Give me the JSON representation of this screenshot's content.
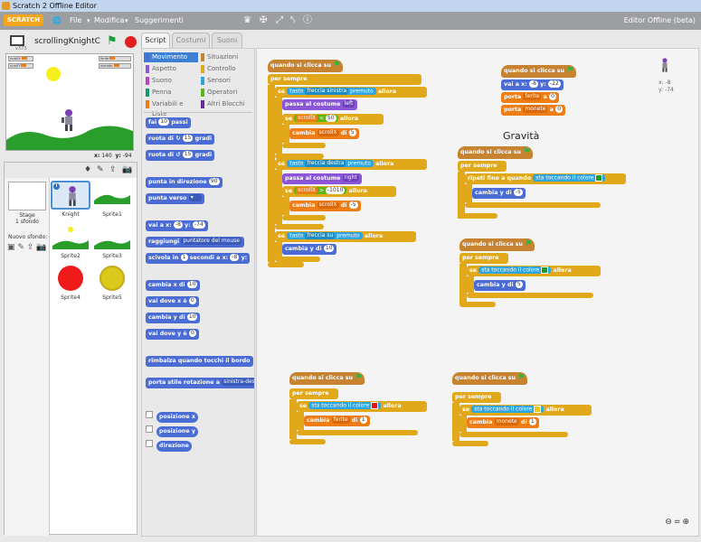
{
  "window": {
    "title": "Scratch 2 Offline Editor"
  },
  "menu": {
    "logo": "SCRATCH",
    "file": "File",
    "edit": "Modifica",
    "tips": "Suggerimenti",
    "edition": "Editor Offline (beta)",
    "tools": [
      "duplicate-stamp-icon",
      "cut-icon",
      "grow-icon",
      "shrink-icon",
      "help-icon"
    ]
  },
  "stage_header": {
    "version": "v373",
    "project_name": "scrollingKnightC"
  },
  "stage": {
    "monitors": [
      "scrollX",
      "scrollY",
      "ferite",
      "monete"
    ],
    "mouse_x_label": "x:",
    "mouse_x": "140",
    "mouse_y_label": "y:",
    "mouse_y": "-94"
  },
  "sprites_panel": {
    "stage_label": "Stage",
    "stage_backdrops": "1 sfondo",
    "new_backdrop": "Nuovo sfondo:",
    "sprites": [
      {
        "name": "Knight",
        "selected": true
      },
      {
        "name": "Sprite1"
      },
      {
        "name": "Sprite2"
      },
      {
        "name": "Sprite3"
      },
      {
        "name": "Sprite4"
      },
      {
        "name": "Sprite5"
      }
    ]
  },
  "tabs": [
    {
      "label": "Script",
      "active": true
    },
    {
      "label": "Costumi"
    },
    {
      "label": "Suoni"
    }
  ],
  "categories": [
    {
      "label": "Movimento",
      "color": "#4a6cd4",
      "active": true
    },
    {
      "label": "Aspetto",
      "color": "#8a55d7"
    },
    {
      "label": "Suono",
      "color": "#bb42c3"
    },
    {
      "label": "Penna",
      "color": "#0e9a6c"
    },
    {
      "label": "Variabili e Liste",
      "color": "#ee7d16"
    },
    {
      "label": "Situazioni",
      "color": "#c88330"
    },
    {
      "label": "Controllo",
      "color": "#e1a91a"
    },
    {
      "label": "Sensori",
      "color": "#2ca5e2"
    },
    {
      "label": "Operatori",
      "color": "#5cb712"
    },
    {
      "label": "Altri Blocchi",
      "color": "#632d99"
    }
  ],
  "palette": {
    "move": "fai",
    "move_val": "10",
    "move_unit": "passi",
    "turn_r": "ruota di",
    "turn_r_val": "15",
    "turn_unit": "gradi",
    "turn_l": "ruota di",
    "turn_l_val": "15",
    "point_dir": "punta in direzione",
    "point_dir_val": "90",
    "point_to": "punta verso",
    "goto": "vai a x:",
    "goto_x": "-8",
    "goto_y_label": "y:",
    "goto_y": "-74",
    "goto_obj": "raggiungi",
    "goto_obj_val": "puntatore del mouse",
    "glide": "scivola in",
    "glide_val": "1",
    "glide_mid": "secondi a x:",
    "glide_x": "-8",
    "glide_y_label": "y:",
    "change_x": "cambia x di",
    "change_x_val": "10",
    "set_x": "vai dove x è",
    "set_x_val": "0",
    "change_y": "cambia y di",
    "change_y_val": "10",
    "set_y": "vai dove y è",
    "set_y_val": "0",
    "bounce": "rimbalza quando tocchi il bordo",
    "rot_style": "porta stile rotazione a",
    "rot_style_val": "sinistra-destra",
    "rep_x": "posizione x",
    "rep_y": "posizione y",
    "rep_dir": "direzione"
  },
  "scripts": {
    "heading": "Gravità",
    "when_flag": "quando si clicca su",
    "forever": "per sempre",
    "if": "se",
    "then": "allora",
    "key": "tasto",
    "pressed": "premuto",
    "key_left": "freccia sinistra",
    "key_right": "freccia destra",
    "key_up": "freccia su",
    "switch_costume": "passa al costume",
    "costume_left": "left",
    "costume_right": "right",
    "change": "cambia",
    "by": "di",
    "scrollX": "scrollX",
    "lt": "<",
    "gt": ">",
    "v50": "50",
    "vneg1010": "-1010",
    "v5": "5",
    "vneg5": "-5",
    "change_y": "cambia y di",
    "v10": "10",
    "goto": "vai a x:",
    "goto_x": "-8",
    "goto_y_label": "y:",
    "goto_y": "-22",
    "set": "porta",
    "ferite": "ferite",
    "monete": "monete",
    "a": "a",
    "v0": "0",
    "repeat_until": "ripeti fino a quando",
    "touching_color": "sta toccando il colore",
    "v1": "1",
    "color_green": "#1f9c2f",
    "color_red": "#e01818",
    "color_yellow": "#e2c91a"
  },
  "sprite_info": {
    "x_label": "x:",
    "x": "-8",
    "y_label": "y:",
    "y": "-74"
  },
  "zoom": {
    "out": "zoom-out-icon",
    "reset": "zoom-reset-icon",
    "in": "zoom-in-icon"
  }
}
